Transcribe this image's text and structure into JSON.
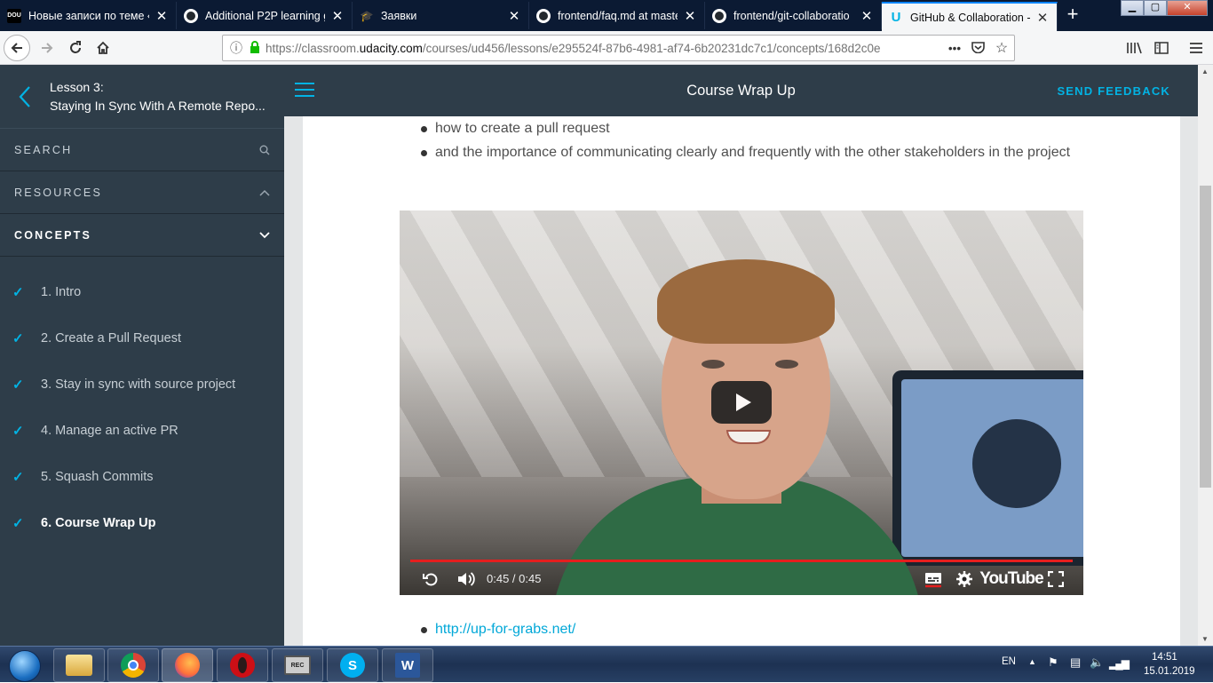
{
  "browser": {
    "tabs": [
      {
        "title": "Новые записи по теме «J",
        "icon": "DOU",
        "icon_bg": "#000000"
      },
      {
        "title": "Additional P2P learning g",
        "icon": "github-icon",
        "icon_bg": "#ffffff"
      },
      {
        "title": "Заявки",
        "icon": "graduation-cap-icon",
        "icon_bg": "#5a6a80"
      },
      {
        "title": "frontend/faq.md at maste",
        "icon": "github-icon",
        "icon_bg": "#ffffff"
      },
      {
        "title": "frontend/git-collaboratio",
        "icon": "github-icon",
        "icon_bg": "#ffffff"
      },
      {
        "title": "GitHub & Collaboration -",
        "icon": "udacity-icon",
        "icon_bg": "#02b3e4"
      }
    ],
    "new_tab": "+",
    "url_prefix": "https://classroom.",
    "url_domain": "udacity.com",
    "url_rest": "/courses/ud456/lessons/e295524f-87b6-4981-af74-6b20231dc7c1/concepts/168d2c0e",
    "url_more": "•••"
  },
  "sidebar": {
    "lesson_label": "Lesson 3:",
    "lesson_title": "Staying In Sync With A Remote Repo...",
    "search_label": "SEARCH",
    "resources_label": "RESOURCES",
    "concepts_label": "CONCEPTS",
    "concepts": [
      {
        "label": "1. Intro",
        "done": true
      },
      {
        "label": "2. Create a Pull Request",
        "done": true
      },
      {
        "label": "3. Stay in sync with source project",
        "done": true
      },
      {
        "label": "4. Manage an active PR",
        "done": true
      },
      {
        "label": "5. Squash Commits",
        "done": true
      },
      {
        "label": "6. Course Wrap Up",
        "done": true,
        "active": true
      }
    ]
  },
  "header": {
    "title": "Course Wrap Up",
    "feedback_label": "SEND FEEDBACK"
  },
  "content": {
    "bullets": [
      "how to create a pull request",
      "and the importance of communicating clearly and frequently with the other stakeholders in the project"
    ],
    "links": [
      "http://up-for-grabs.net/"
    ]
  },
  "video": {
    "time": "0:45 / 0:45",
    "progress": 1.0,
    "brand": "YouTube"
  },
  "taskbar": {
    "lang": "EN",
    "time": "14:51",
    "date": "15.01.2019",
    "apps": [
      "explorer",
      "chrome",
      "firefox",
      "opera",
      "recorder",
      "skype",
      "word"
    ]
  }
}
